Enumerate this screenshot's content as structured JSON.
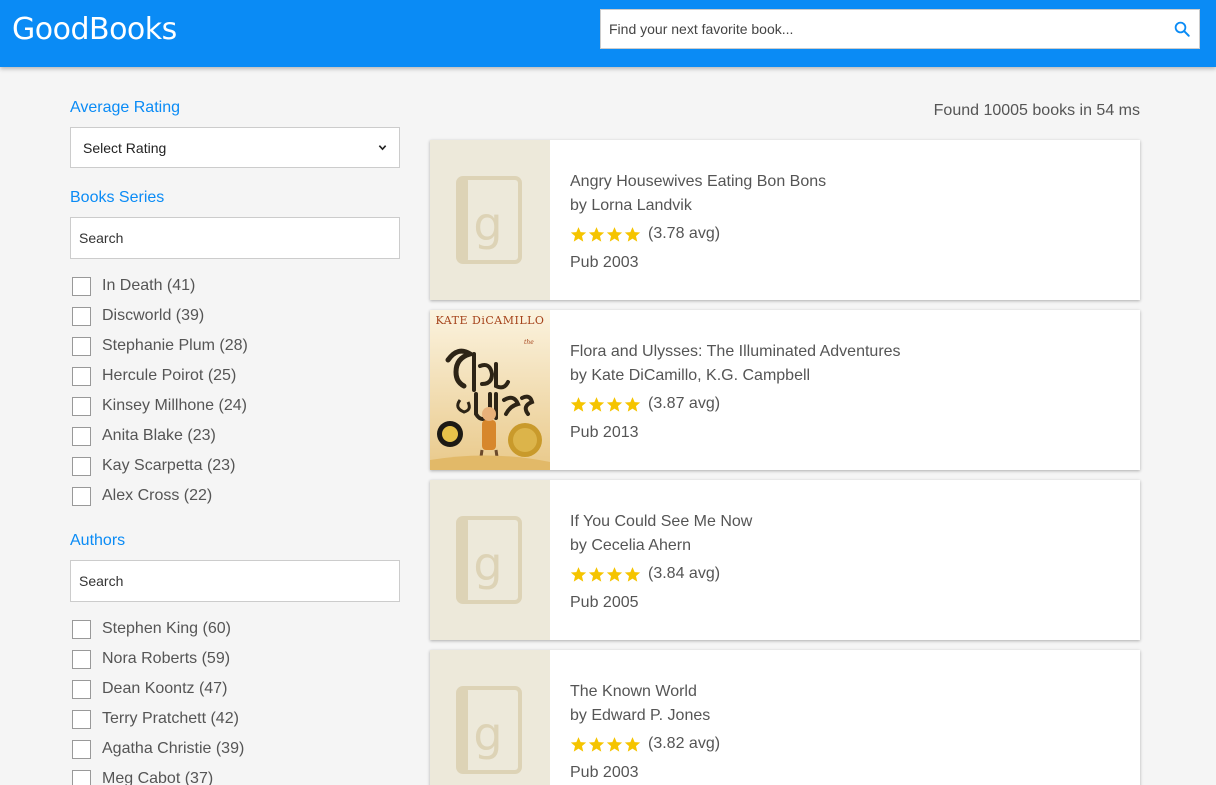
{
  "header": {
    "logo": "GoodBooks",
    "search_placeholder": "Find your next favorite book...",
    "brand_color": "#0a8bf5"
  },
  "sidebar": {
    "rating": {
      "title": "Average Rating",
      "selected": "Select Rating"
    },
    "series": {
      "title": "Books Series",
      "search_placeholder": "Search",
      "items": [
        {
          "label": "In Death (41)"
        },
        {
          "label": "Discworld (39)"
        },
        {
          "label": "Stephanie Plum (28)"
        },
        {
          "label": "Hercule Poirot (25)"
        },
        {
          "label": "Kinsey Millhone (24)"
        },
        {
          "label": "Anita Blake (23)"
        },
        {
          "label": "Kay Scarpetta (23)"
        },
        {
          "label": "Alex Cross (22)"
        }
      ]
    },
    "authors": {
      "title": "Authors",
      "search_placeholder": "Search",
      "items": [
        {
          "label": "Stephen King (60)"
        },
        {
          "label": "Nora Roberts (59)"
        },
        {
          "label": "Dean Koontz (47)"
        },
        {
          "label": "Terry Pratchett (42)"
        },
        {
          "label": "Agatha Christie (39)"
        },
        {
          "label": "Meg Cabot (37)"
        }
      ]
    }
  },
  "results": {
    "summary": "Found 10005 books in 54 ms",
    "books": [
      {
        "title": "Angry Housewives Eating Bon Bons",
        "author": "by Lorna Landvik",
        "rating": "(3.78 avg)",
        "stars": 4,
        "pub": "Pub 2003",
        "cover": "placeholder"
      },
      {
        "title": "Flora and Ulysses: The Illuminated Adventures",
        "author": "by Kate DiCamillo, K.G. Campbell",
        "rating": "(3.87 avg)",
        "stars": 4,
        "pub": "Pub 2013",
        "cover": "flora-ulysses",
        "cover_author": "KATE DiCAMILLO",
        "cover_title_1": "Flora",
        "cover_title_2": "Ulysses"
      },
      {
        "title": "If You Could See Me Now",
        "author": "by Cecelia Ahern",
        "rating": "(3.84 avg)",
        "stars": 4,
        "pub": "Pub 2005",
        "cover": "placeholder"
      },
      {
        "title": "The Known World",
        "author": "by Edward P. Jones",
        "rating": "(3.82 avg)",
        "stars": 4,
        "pub": "Pub 2003",
        "cover": "placeholder"
      }
    ]
  },
  "colors": {
    "star": "#f5c400",
    "placeholder_bg": "#ede9da",
    "placeholder_fg": "#ddd3b6"
  }
}
